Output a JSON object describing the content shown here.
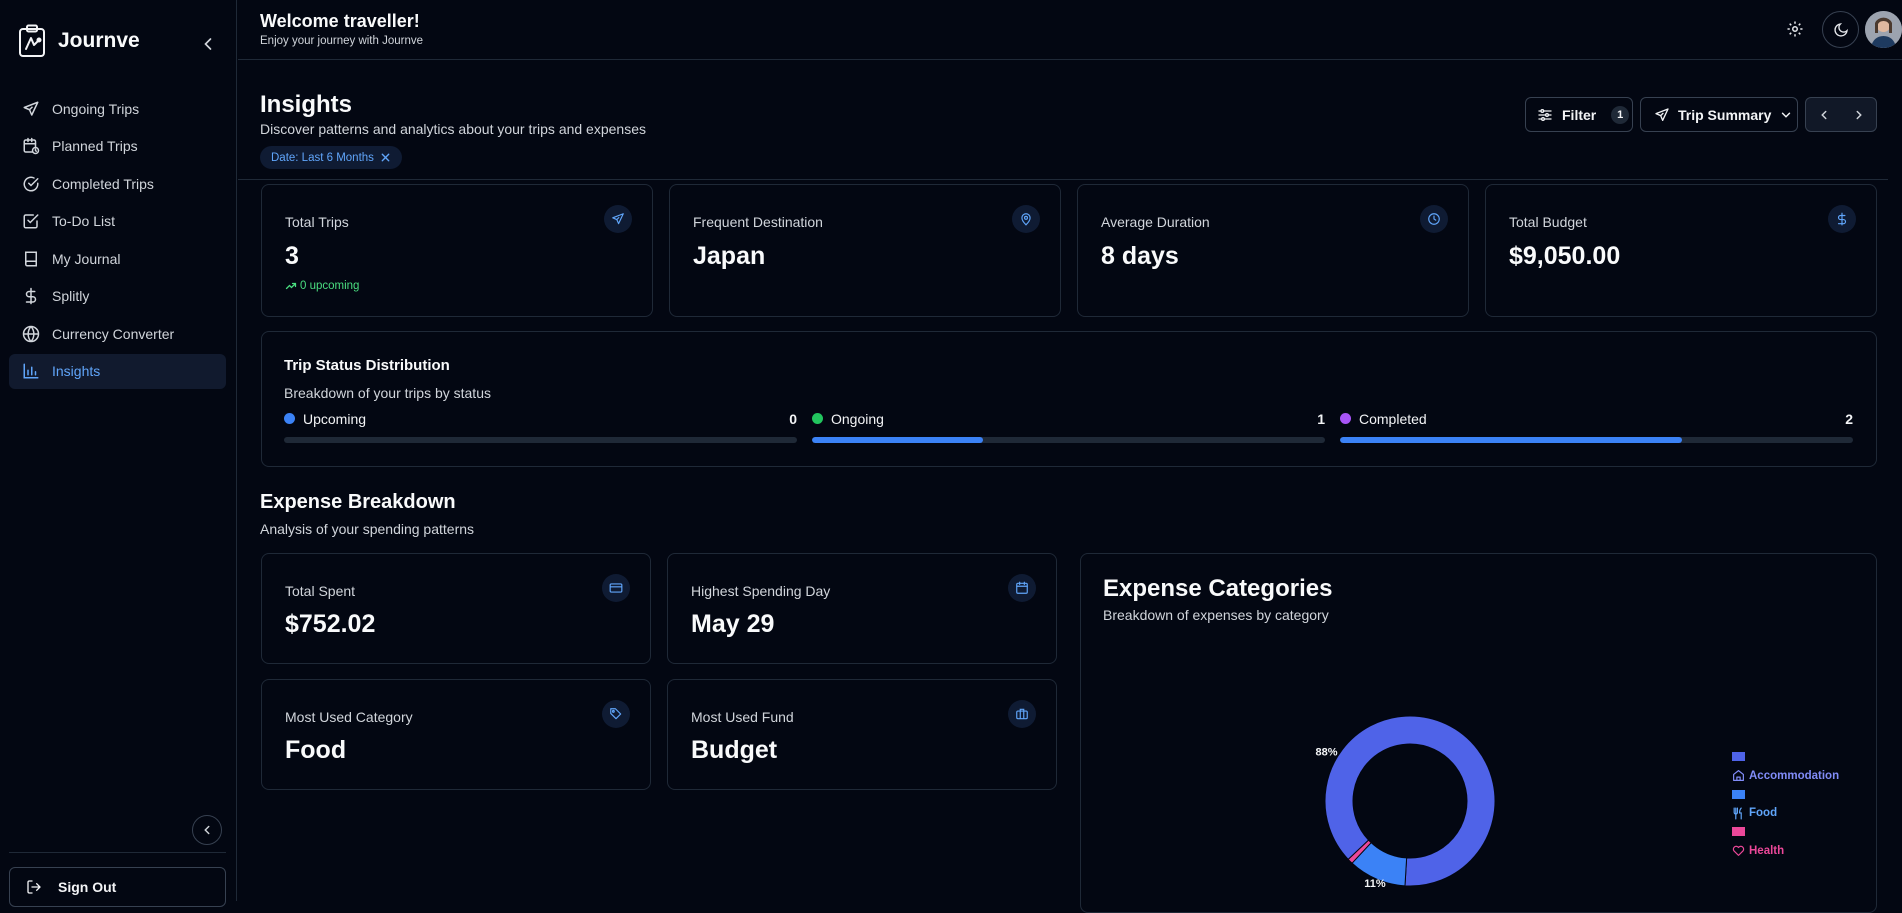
{
  "app": {
    "name": "Journve"
  },
  "sidebar": {
    "items": [
      {
        "label": "Ongoing Trips",
        "icon": "plane-icon"
      },
      {
        "label": "Planned Trips",
        "icon": "calendar-clock-icon"
      },
      {
        "label": "Completed Trips",
        "icon": "check-circle-icon"
      },
      {
        "label": "To-Do List",
        "icon": "checkbox-icon"
      },
      {
        "label": "My Journal",
        "icon": "book-icon"
      },
      {
        "label": "Splitly",
        "icon": "dollar-icon"
      },
      {
        "label": "Currency Converter",
        "icon": "globe-icon"
      },
      {
        "label": "Insights",
        "icon": "bar-chart-icon",
        "active": true
      }
    ],
    "sign_out": "Sign Out"
  },
  "header": {
    "welcome": "Welcome traveller!",
    "subtitle": "Enjoy your journey with Journve"
  },
  "page": {
    "title": "Insights",
    "subtitle": "Discover patterns and analytics about your trips and expenses",
    "filter_chip": "Date: Last 6 Months",
    "filter_label": "Filter",
    "filter_count": "1",
    "summary_label": "Trip Summary"
  },
  "stats": [
    {
      "label": "Total Trips",
      "value": "3",
      "icon": "plane-icon",
      "trend": "0 upcoming"
    },
    {
      "label": "Frequent Destination",
      "value": "Japan",
      "icon": "map-pin-icon"
    },
    {
      "label": "Average Duration",
      "value": "8 days",
      "icon": "clock-icon"
    },
    {
      "label": "Total Budget",
      "value": "$9,050.00",
      "icon": "dollar-icon"
    }
  ],
  "trip_status": {
    "title": "Trip Status Distribution",
    "subtitle": "Breakdown of your trips by status",
    "items": [
      {
        "label": "Upcoming",
        "count": "0",
        "color": "#3b82f6",
        "fill": 0
      },
      {
        "label": "Ongoing",
        "count": "1",
        "color": "#22c55e",
        "fill": 0.333
      },
      {
        "label": "Completed",
        "count": "2",
        "color": "#a855f7",
        "fill": 0.667
      }
    ]
  },
  "expense": {
    "title": "Expense Breakdown",
    "subtitle": "Analysis of your spending patterns",
    "cards": [
      {
        "label": "Total Spent",
        "value": "$752.02",
        "icon": "credit-card-icon"
      },
      {
        "label": "Highest Spending Day",
        "value": "May 29",
        "icon": "calendar-icon"
      },
      {
        "label": "Most Used Category",
        "value": "Food",
        "icon": "tag-icon"
      },
      {
        "label": "Most Used Fund",
        "value": "Budget",
        "icon": "briefcase-icon"
      }
    ],
    "categories_title": "Expense Categories",
    "categories_subtitle": "Breakdown of expenses by category"
  },
  "chart_data": {
    "type": "pie",
    "categories": [
      "Accommodation",
      "Food",
      "Health"
    ],
    "values": [
      88,
      11,
      1
    ],
    "data_labels": [
      "88%",
      "11%",
      ""
    ],
    "colors": [
      "#4f63e8",
      "#3b82f6",
      "#ec4899"
    ],
    "legend_colors": [
      "#4f63e8",
      "#3b82f6",
      "#ec4899"
    ],
    "legend_position": "right"
  }
}
